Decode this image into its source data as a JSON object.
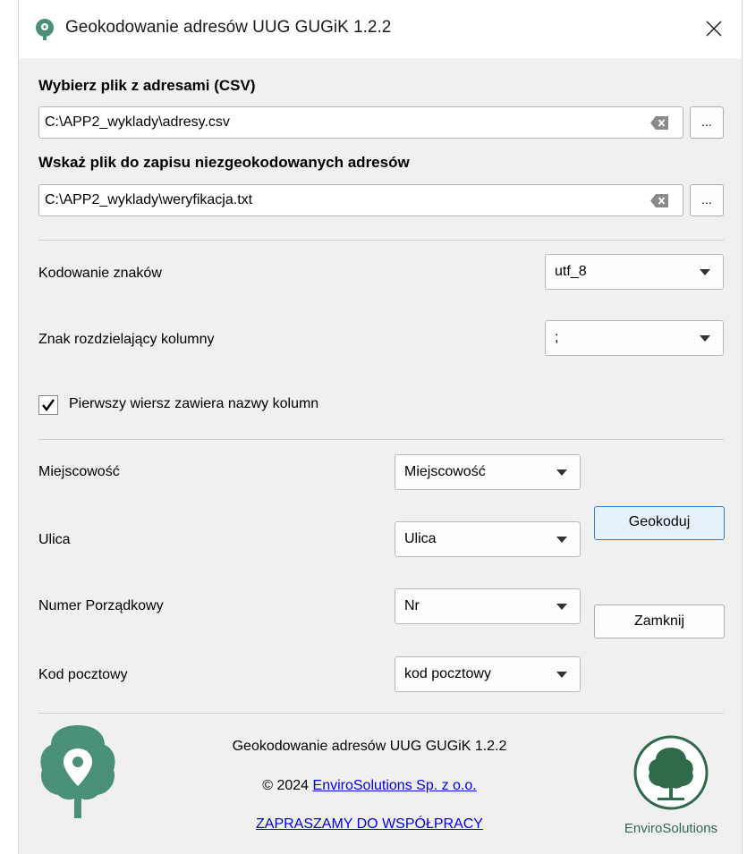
{
  "window": {
    "title": "Geokodowanie adresów UUG GUGiK 1.2.2"
  },
  "input_file": {
    "label": "Wybierz plik z adresami (CSV)",
    "value": "C:\\APP2_wyklady\\adresy.csv",
    "browse_label": "..."
  },
  "output_file": {
    "label": "Wskaż plik do zapisu niezgeokodowanych adresów",
    "value": "C:\\APP2_wyklady\\weryfikacja.txt",
    "browse_label": "..."
  },
  "encoding": {
    "label": "Kodowanie znaków",
    "value": "utf_8"
  },
  "separator": {
    "label": "Znak rozdzielający kolumny",
    "value": ";"
  },
  "header_row": {
    "label": "Pierwszy wiersz zawiera nazwy kolumn",
    "checked": true
  },
  "mapping": {
    "city": {
      "label": "Miejscowość",
      "value": "Miejscowość"
    },
    "street": {
      "label": "Ulica",
      "value": "Ulica"
    },
    "number": {
      "label": "Numer Porządkowy",
      "value": "Nr"
    },
    "postcode": {
      "label": "Kod pocztowy",
      "value": "kod pocztowy"
    }
  },
  "buttons": {
    "geocode": "Geokoduj",
    "close": "Zamknij"
  },
  "footer": {
    "title": "Geokodowanie adresów UUG GUGiK 1.2.2",
    "copyright_prefix": "© 2024 ",
    "company_link": "EnviroSolutions Sp. z o.o.",
    "cooperation_link": "ZAPRASZAMY DO WSPÓŁPRACY",
    "logo_caption": "EnviroSolutions"
  },
  "colors": {
    "brand_green": "#4a8f7a",
    "dark_green": "#2f6b4a",
    "link": "#0000ee",
    "default_button_border": "#2d7fd4"
  }
}
